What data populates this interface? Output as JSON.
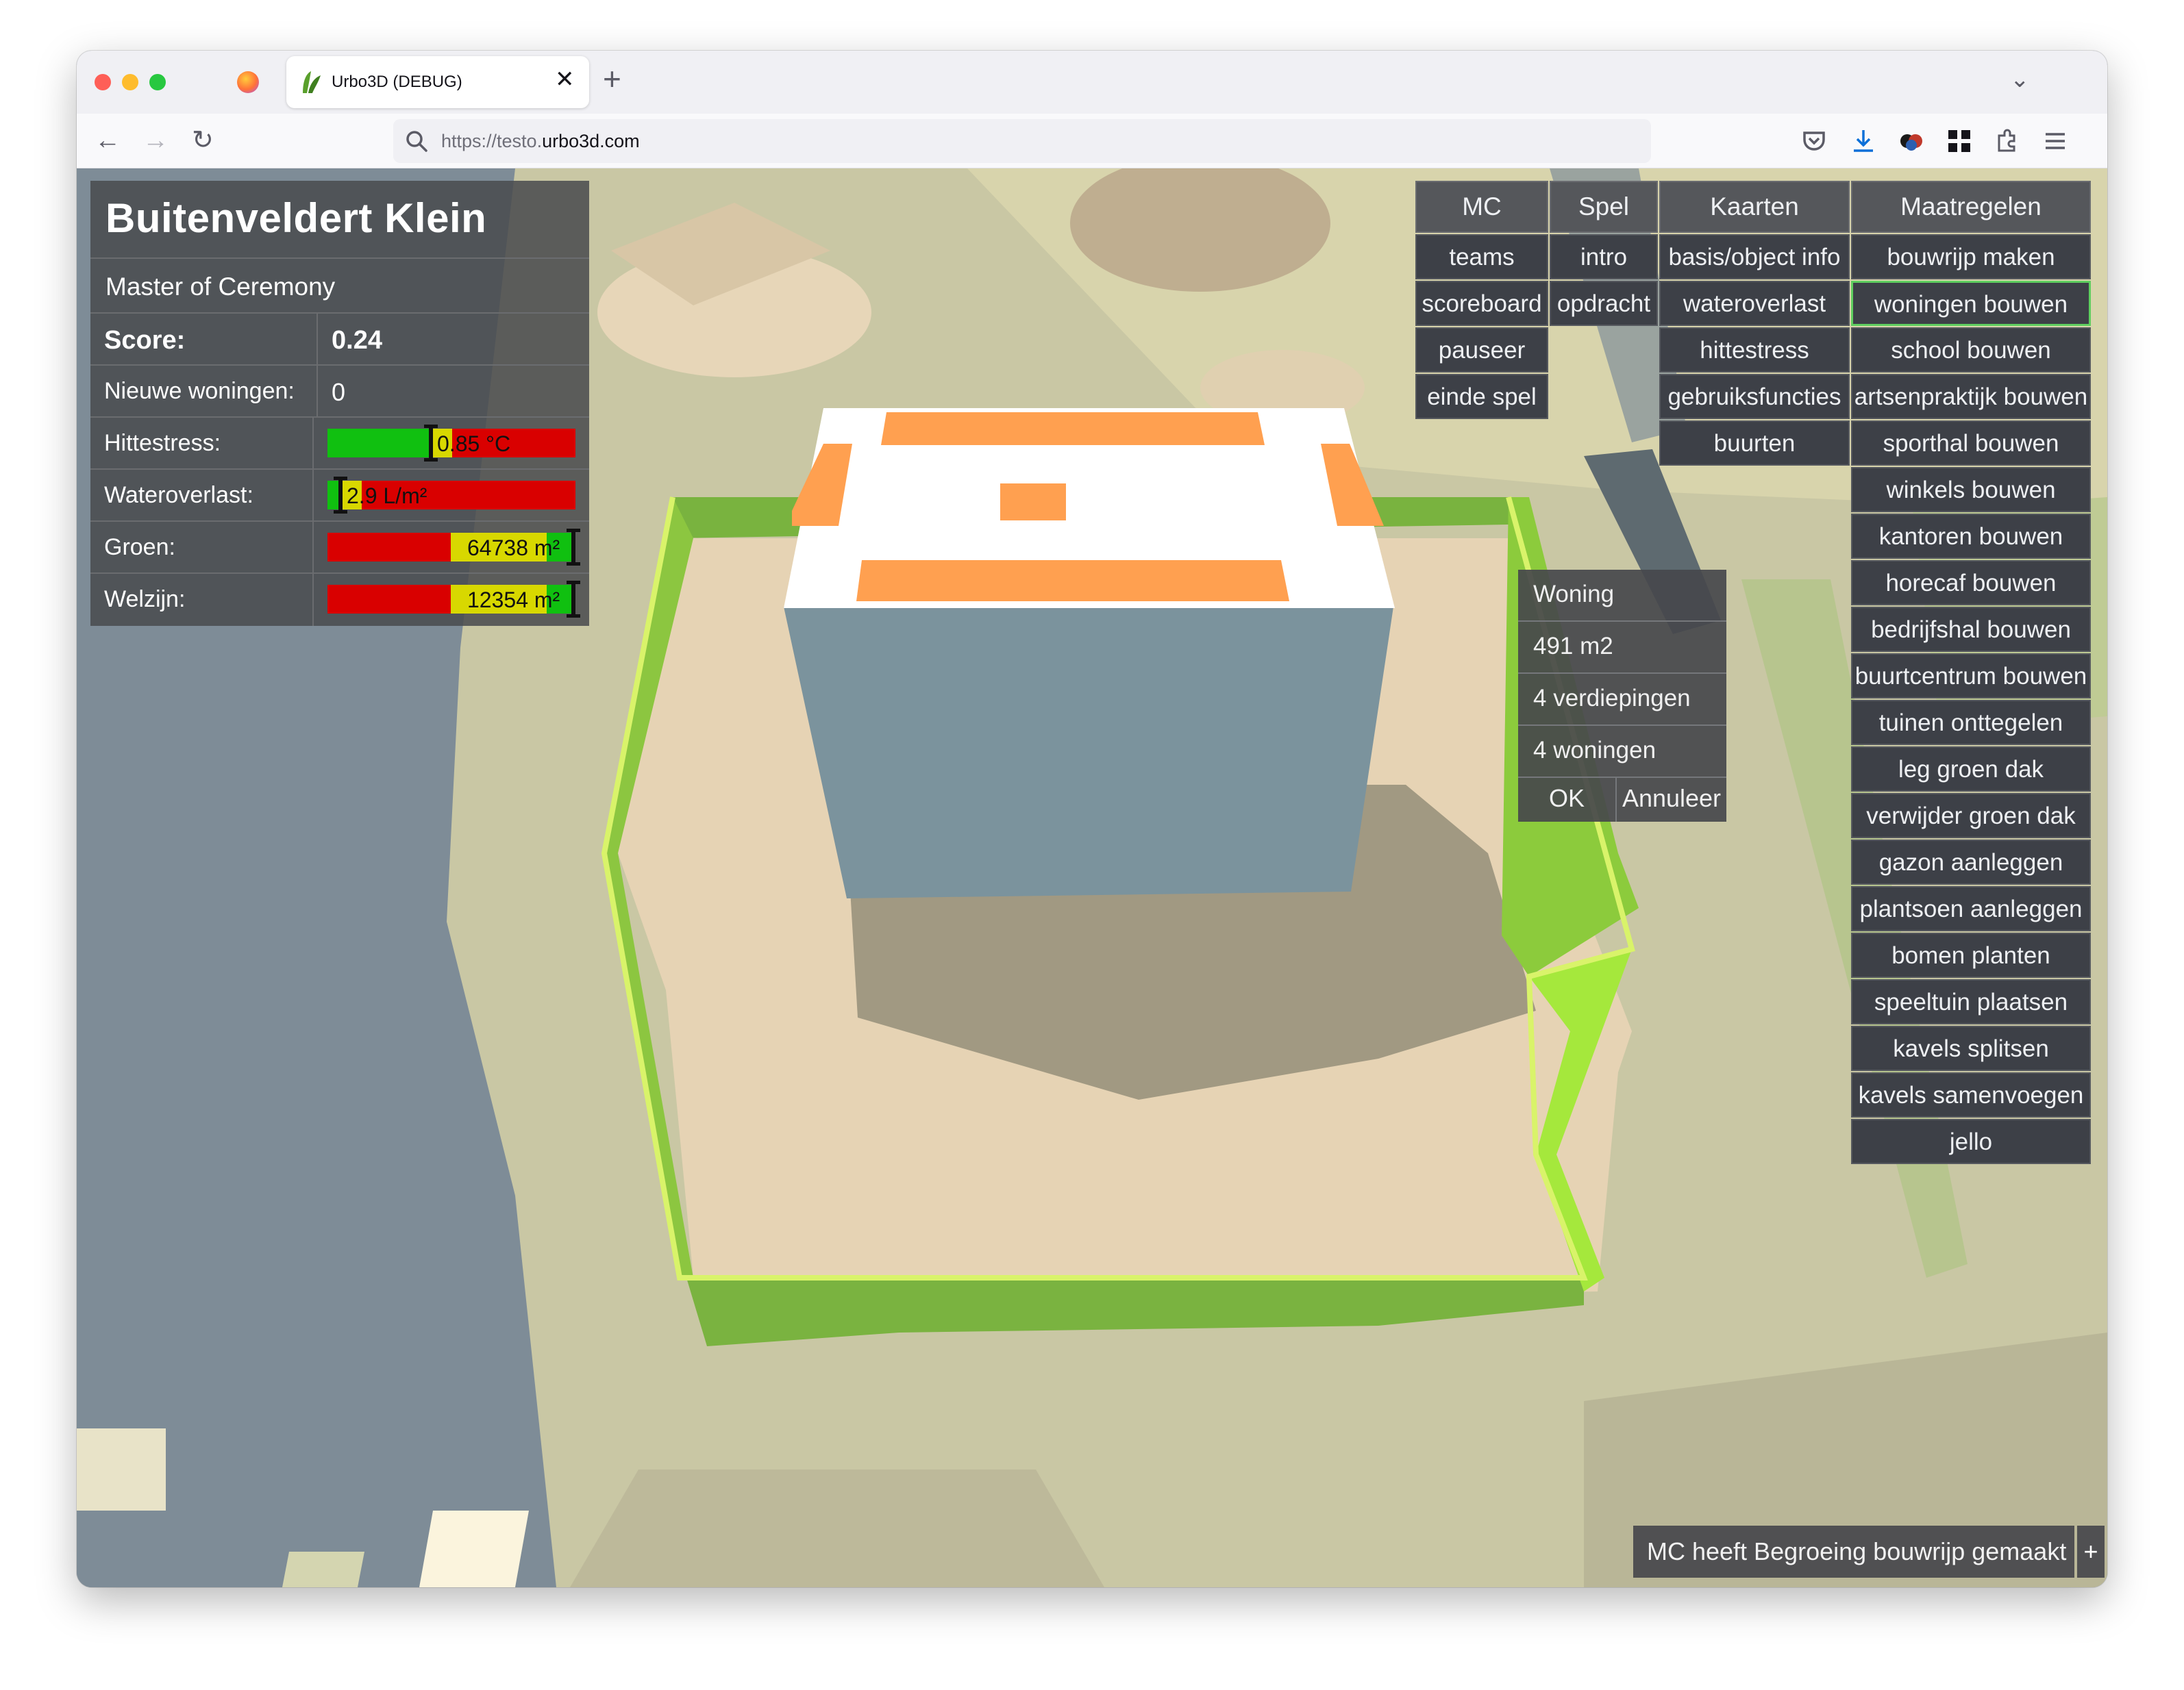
{
  "browser": {
    "tab_title": "Urbo3D (DEBUG)",
    "tab_close": "✕",
    "new_tab": "+",
    "tab_list": "⌄",
    "back": "←",
    "forward": "→",
    "reload": "↻",
    "url_scheme": "https://testo.",
    "url_host": "urbo3d.com"
  },
  "scoreboard": {
    "title": "Buitenveldert Klein",
    "subtitle": "Master of Ceremony",
    "score_label": "Score:",
    "score_value": "0.24",
    "new_homes_label": "Nieuwe woningen:",
    "new_homes_value": "0",
    "heat_label": "Hittestress:",
    "heat_value": "0.85 °C",
    "heat_level": 0.28,
    "water_label": "Wateroverlast:",
    "water_value": "2.9 L/m²",
    "water_level": 0.04,
    "green_label": "Groen:",
    "green_value": "64738 m²",
    "green_level": 0.99,
    "welfare_label": "Welzijn:",
    "welfare_value": "12354 m²",
    "welfare_level": 0.99
  },
  "menu": {
    "col_mc": {
      "header": "MC",
      "items": [
        "teams",
        "scoreboard",
        "pauseer",
        "einde spel"
      ]
    },
    "col_spel": {
      "header": "Spel",
      "items": [
        "intro",
        "opdracht"
      ]
    },
    "col_kaarten": {
      "header": "Kaarten",
      "items": [
        "basis/object info",
        "wateroverlast",
        "hittestress",
        "gebruiksfuncties",
        "buurten"
      ]
    },
    "col_maatregelen": {
      "header": "Maatregelen",
      "selected": "woningen bouwen",
      "items": [
        "bouwrijp maken",
        "woningen bouwen",
        "school bouwen",
        "artsenpraktijk bouwen",
        "sporthal bouwen",
        "winkels bouwen",
        "kantoren bouwen",
        "horecaf bouwen",
        "bedrijfshal bouwen",
        "buurtcentrum bouwen",
        "tuinen onttegelen",
        "leg groen dak",
        "verwijder groen dak",
        "gazon aanleggen",
        "plantsoen aanleggen",
        "bomen planten",
        "speeltuin plaatsen",
        "kavels splitsen",
        "kavels samenvoegen",
        "jello"
      ]
    }
  },
  "dialog": {
    "title": "Woning",
    "area": "491 m2",
    "floors": "4 verdiepingen",
    "homes": "4 woningen",
    "ok": "OK",
    "cancel": "Annuleer"
  },
  "toast": {
    "message": "MC heeft Begroeing bouwrijp gemaakt",
    "expand": "+"
  },
  "colors": {
    "bar_red": "#d90000",
    "bar_green": "#10c010",
    "bar_yellow": "#d8d800",
    "plot_outline": "#9ee33c",
    "roof_accent": "#ffa050",
    "building": "#7b939d",
    "selected_border": "#5fcf5f"
  }
}
